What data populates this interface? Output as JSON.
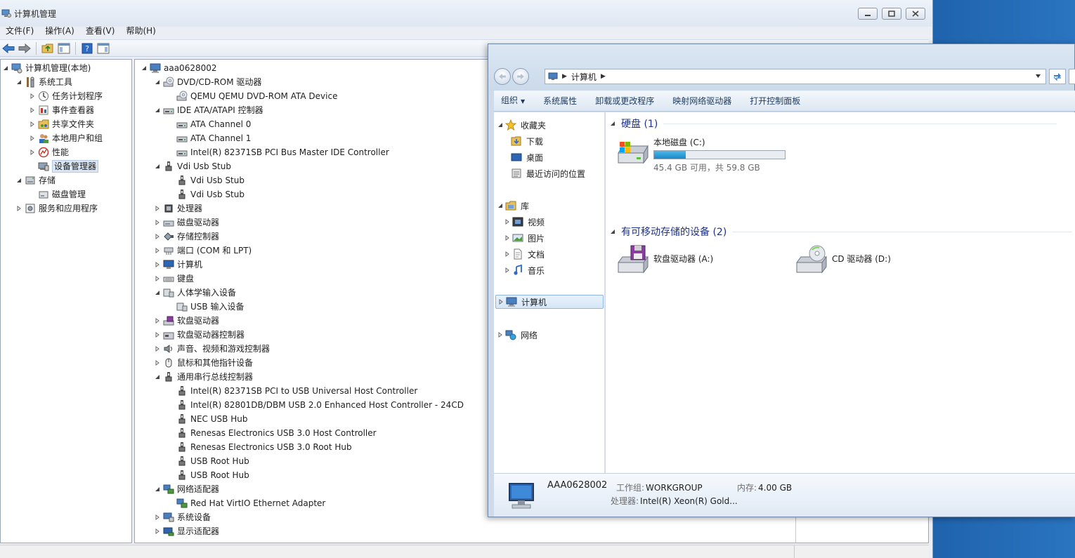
{
  "mmc": {
    "title": "计算机管理",
    "menu": [
      "文件(F)",
      "操作(A)",
      "查看(V)",
      "帮助(H)"
    ],
    "left_tree": [
      {
        "label": "计算机管理(本地)",
        "icon": "computer-management-icon",
        "level": 0,
        "expanded": true
      },
      {
        "label": "系统工具",
        "icon": "system-tools-icon",
        "level": 1,
        "expanded": true
      },
      {
        "label": "任务计划程序",
        "icon": "task-scheduler-icon",
        "level": 2,
        "expanded": false
      },
      {
        "label": "事件查看器",
        "icon": "event-viewer-icon",
        "level": 2,
        "expanded": false
      },
      {
        "label": "共享文件夹",
        "icon": "shared-folders-icon",
        "level": 2,
        "expanded": false
      },
      {
        "label": "本地用户和组",
        "icon": "local-users-icon",
        "level": 2,
        "expanded": false
      },
      {
        "label": "性能",
        "icon": "performance-icon",
        "level": 2,
        "expanded": false
      },
      {
        "label": "设备管理器",
        "icon": "device-manager-icon",
        "level": 2,
        "selected": true
      },
      {
        "label": "存储",
        "icon": "storage-icon",
        "level": 1,
        "expanded": true
      },
      {
        "label": "磁盘管理",
        "icon": "disk-management-icon",
        "level": 2
      },
      {
        "label": "服务和应用程序",
        "icon": "services-apps-icon",
        "level": 1,
        "expanded": false
      }
    ],
    "device_tree": [
      {
        "label": "aaa0628002",
        "icon": "computer-icon",
        "level": 0,
        "expanded": true
      },
      {
        "label": "DVD/CD-ROM 驱动器",
        "icon": "dvd-drive-icon",
        "level": 1,
        "expanded": true
      },
      {
        "label": "QEMU QEMU DVD-ROM ATA Device",
        "icon": "dvd-drive-icon",
        "level": 2
      },
      {
        "label": "IDE ATA/ATAPI 控制器",
        "icon": "ide-controller-icon",
        "level": 1,
        "expanded": true
      },
      {
        "label": "ATA Channel 0",
        "icon": "ide-controller-icon",
        "level": 2
      },
      {
        "label": "ATA Channel 1",
        "icon": "ide-controller-icon",
        "level": 2
      },
      {
        "label": "Intel(R) 82371SB PCI Bus Master IDE Controller",
        "icon": "ide-controller-icon",
        "level": 2
      },
      {
        "label": "Vdi Usb Stub",
        "icon": "usb-icon",
        "level": 1,
        "expanded": true
      },
      {
        "label": "Vdi Usb Stub",
        "icon": "usb-icon",
        "level": 2
      },
      {
        "label": "Vdi Usb Stub",
        "icon": "usb-icon",
        "level": 2
      },
      {
        "label": "处理器",
        "icon": "processor-icon",
        "level": 1,
        "expanded": false
      },
      {
        "label": "磁盘驱动器",
        "icon": "disk-drive-icon",
        "level": 1,
        "expanded": false
      },
      {
        "label": "存储控制器",
        "icon": "storage-controller-icon",
        "level": 1,
        "expanded": false
      },
      {
        "label": "端口 (COM 和 LPT)",
        "icon": "port-icon",
        "level": 1,
        "expanded": false
      },
      {
        "label": "计算机",
        "icon": "monitor-icon",
        "level": 1,
        "expanded": false
      },
      {
        "label": "键盘",
        "icon": "keyboard-icon",
        "level": 1,
        "expanded": false
      },
      {
        "label": "人体学输入设备",
        "icon": "hid-icon",
        "level": 1,
        "expanded": true
      },
      {
        "label": "USB 输入设备",
        "icon": "hid-icon",
        "level": 2
      },
      {
        "label": "软盘驱动器",
        "icon": "floppy-drive-icon",
        "level": 1,
        "expanded": false
      },
      {
        "label": "软盘驱动器控制器",
        "icon": "floppy-controller-icon",
        "level": 1,
        "expanded": false
      },
      {
        "label": "声音、视频和游戏控制器",
        "icon": "speaker-icon",
        "level": 1,
        "expanded": false
      },
      {
        "label": "鼠标和其他指针设备",
        "icon": "mouse-icon",
        "level": 1,
        "expanded": false
      },
      {
        "label": "通用串行总线控制器",
        "icon": "usb-icon",
        "level": 1,
        "expanded": true
      },
      {
        "label": "Intel(R) 82371SB PCI to USB Universal Host Controller",
        "icon": "usb-icon",
        "level": 2
      },
      {
        "label": "Intel(R) 82801DB/DBM USB 2.0 Enhanced Host Controller - 24CD",
        "icon": "usb-icon",
        "level": 2
      },
      {
        "label": "NEC USB Hub",
        "icon": "usb-icon",
        "level": 2
      },
      {
        "label": "Renesas Electronics USB 3.0 Host Controller",
        "icon": "usb-icon",
        "level": 2
      },
      {
        "label": "Renesas Electronics USB 3.0 Root Hub",
        "icon": "usb-icon",
        "level": 2
      },
      {
        "label": "USB Root Hub",
        "icon": "usb-icon",
        "level": 2
      },
      {
        "label": "USB Root Hub",
        "icon": "usb-icon",
        "level": 2
      },
      {
        "label": "网络适配器",
        "icon": "network-adapter-icon",
        "level": 1,
        "expanded": true
      },
      {
        "label": "Red Hat VirtIO Ethernet Adapter",
        "icon": "network-adapter-icon",
        "level": 2
      },
      {
        "label": "系统设备",
        "icon": "system-device-icon",
        "level": 1,
        "expanded": false
      },
      {
        "label": "显示适配器",
        "icon": "display-adapter-icon",
        "level": 1,
        "expanded": false
      }
    ]
  },
  "explorer": {
    "address": "计算机",
    "commands": [
      {
        "label": "组织",
        "dropdown": true
      },
      {
        "label": "系统属性"
      },
      {
        "label": "卸载或更改程序"
      },
      {
        "label": "映射网络驱动器"
      },
      {
        "label": "打开控制面板"
      }
    ],
    "nav": {
      "favorites": {
        "label": "收藏夹",
        "items": [
          "下载",
          "桌面",
          "最近访问的位置"
        ]
      },
      "libraries": {
        "label": "库",
        "items": [
          "视频",
          "图片",
          "文档",
          "音乐"
        ]
      },
      "computer": "计算机",
      "network": "网络"
    },
    "groups": {
      "hdd": "硬盘 (1)",
      "removable": "有可移动存储的设备 (2)"
    },
    "drives": {
      "c": {
        "name": "本地磁盘 (C:)",
        "free_text": "45.4 GB 可用，共 59.8 GB",
        "used_fraction": 0.24
      },
      "a": {
        "name": "软盘驱动器 (A:)"
      },
      "d": {
        "name": "CD 驱动器 (D:)"
      }
    },
    "details": {
      "pc_name": "AAA0628002",
      "workgroup_label": "工作组:",
      "workgroup": "WORKGROUP",
      "memory_label": "内存:",
      "memory": "4.00 GB",
      "cpu_label": "处理器:",
      "cpu": "Intel(R) Xeon(R) Gold..."
    }
  },
  "colors": {
    "accent": "#1e3287",
    "selection": "#dbe6f4",
    "bar_fill": "#1d87c8"
  }
}
